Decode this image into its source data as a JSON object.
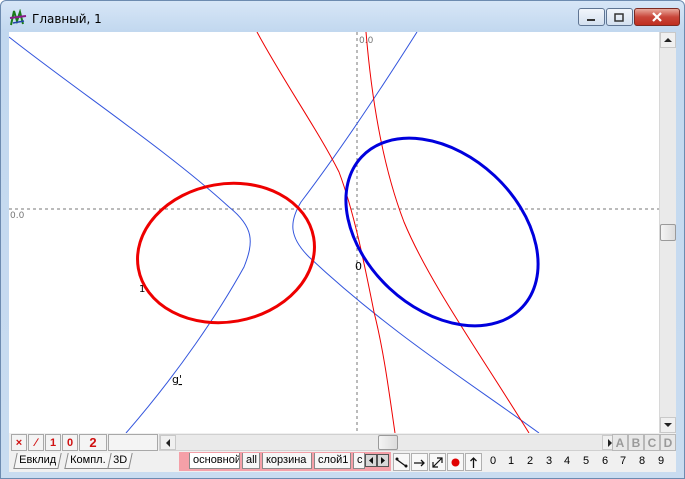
{
  "window": {
    "title": "Главный, 1"
  },
  "canvas": {
    "origin_label_top": "0.0",
    "origin_label_left": "0.0",
    "point_labels": [
      "1",
      "0",
      "g'"
    ]
  },
  "colors": {
    "red_curve": "#ee0000",
    "blue_curve": "#0000dd",
    "thin_blue": "#3355dd",
    "axis": "#888888",
    "layer_area": "#f5a0a8"
  },
  "toolbar": {
    "tools": [
      "×",
      "∕",
      "1",
      "0",
      "2"
    ],
    "letters": [
      "A",
      "B",
      "C",
      "D"
    ]
  },
  "tabs": {
    "left": [
      "Евклид",
      "Компл.",
      "3D"
    ],
    "layers": [
      "основной",
      "all",
      "корзина",
      "слой1",
      "с"
    ]
  },
  "numbers": [
    "0",
    "1",
    "2",
    "3",
    "4",
    "5",
    "6",
    "7",
    "8",
    "9"
  ],
  "icons": [
    "segment-icon",
    "arrow-right-icon",
    "diagonal-arrow-icon",
    "red-dot-icon",
    "arrow-up-icon"
  ]
}
